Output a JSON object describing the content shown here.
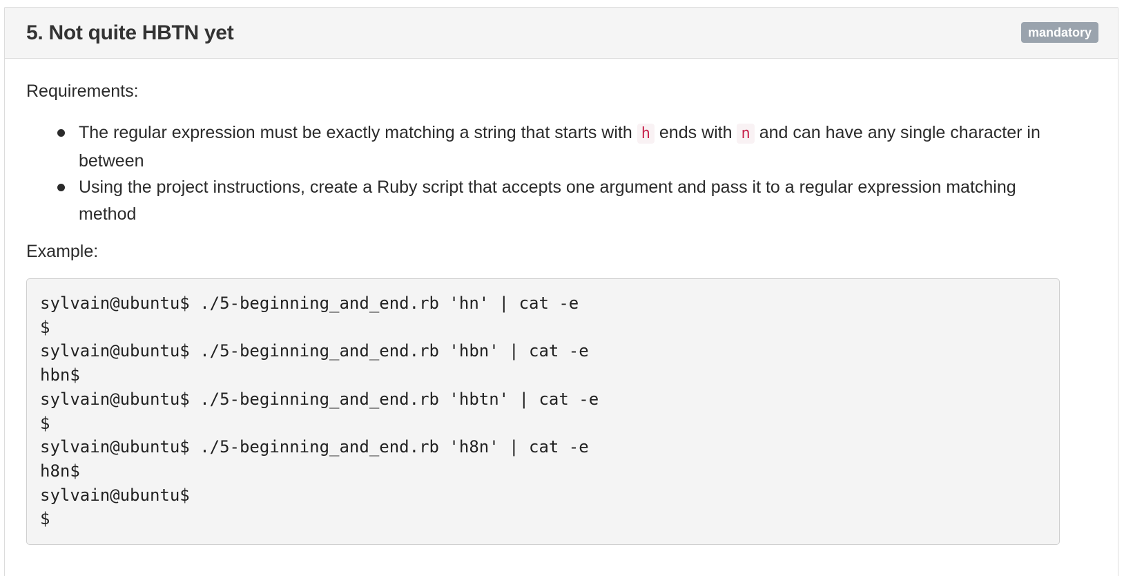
{
  "task": {
    "title": "5. Not quite HBTN yet",
    "badge": "mandatory"
  },
  "requirements": {
    "label": "Requirements:",
    "items": [
      {
        "part1": "The regular expression must be exactly matching a string that starts with",
        "code1": "h",
        "part2": "ends with",
        "code2": "n",
        "part3": "and can have any single character in between"
      },
      {
        "text": "Using the project instructions, create a Ruby script that accepts one argument and pass it to a regular expression matching method"
      }
    ]
  },
  "example": {
    "label": "Example:",
    "lines": [
      "sylvain@ubuntu$ ./5-beginning_and_end.rb 'hn' | cat -e",
      "$",
      "sylvain@ubuntu$ ./5-beginning_and_end.rb 'hbn' | cat -e",
      "hbn$",
      "sylvain@ubuntu$ ./5-beginning_and_end.rb 'hbtn' | cat -e",
      "$",
      "sylvain@ubuntu$ ./5-beginning_and_end.rb 'h8n' | cat -e",
      "h8n$",
      "sylvain@ubuntu$",
      "$"
    ]
  },
  "colors": {
    "badge_bg": "#9aa3ad",
    "inline_code_text": "#c7254e",
    "inline_code_bg": "#f9f2f4",
    "code_block_bg": "#f4f4f4",
    "header_bg": "#f5f5f5"
  }
}
